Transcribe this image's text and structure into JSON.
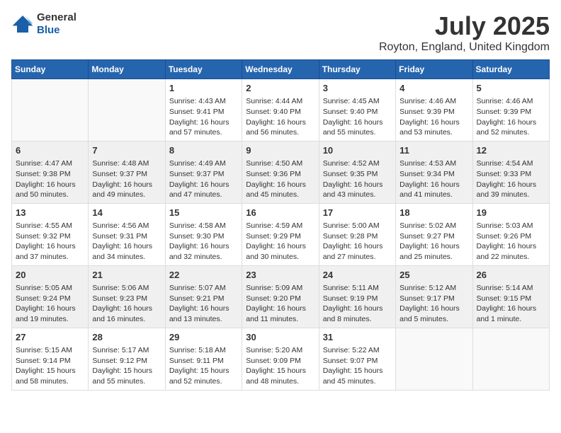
{
  "app": {
    "logo_line1": "General",
    "logo_line2": "Blue"
  },
  "title": "July 2025",
  "subtitle": "Royton, England, United Kingdom",
  "days_of_week": [
    "Sunday",
    "Monday",
    "Tuesday",
    "Wednesday",
    "Thursday",
    "Friday",
    "Saturday"
  ],
  "weeks": [
    [
      {
        "day": "",
        "info": ""
      },
      {
        "day": "",
        "info": ""
      },
      {
        "day": "1",
        "info": "Sunrise: 4:43 AM\nSunset: 9:41 PM\nDaylight: 16 hours and 57 minutes."
      },
      {
        "day": "2",
        "info": "Sunrise: 4:44 AM\nSunset: 9:40 PM\nDaylight: 16 hours and 56 minutes."
      },
      {
        "day": "3",
        "info": "Sunrise: 4:45 AM\nSunset: 9:40 PM\nDaylight: 16 hours and 55 minutes."
      },
      {
        "day": "4",
        "info": "Sunrise: 4:46 AM\nSunset: 9:39 PM\nDaylight: 16 hours and 53 minutes."
      },
      {
        "day": "5",
        "info": "Sunrise: 4:46 AM\nSunset: 9:39 PM\nDaylight: 16 hours and 52 minutes."
      }
    ],
    [
      {
        "day": "6",
        "info": "Sunrise: 4:47 AM\nSunset: 9:38 PM\nDaylight: 16 hours and 50 minutes."
      },
      {
        "day": "7",
        "info": "Sunrise: 4:48 AM\nSunset: 9:37 PM\nDaylight: 16 hours and 49 minutes."
      },
      {
        "day": "8",
        "info": "Sunrise: 4:49 AM\nSunset: 9:37 PM\nDaylight: 16 hours and 47 minutes."
      },
      {
        "day": "9",
        "info": "Sunrise: 4:50 AM\nSunset: 9:36 PM\nDaylight: 16 hours and 45 minutes."
      },
      {
        "day": "10",
        "info": "Sunrise: 4:52 AM\nSunset: 9:35 PM\nDaylight: 16 hours and 43 minutes."
      },
      {
        "day": "11",
        "info": "Sunrise: 4:53 AM\nSunset: 9:34 PM\nDaylight: 16 hours and 41 minutes."
      },
      {
        "day": "12",
        "info": "Sunrise: 4:54 AM\nSunset: 9:33 PM\nDaylight: 16 hours and 39 minutes."
      }
    ],
    [
      {
        "day": "13",
        "info": "Sunrise: 4:55 AM\nSunset: 9:32 PM\nDaylight: 16 hours and 37 minutes."
      },
      {
        "day": "14",
        "info": "Sunrise: 4:56 AM\nSunset: 9:31 PM\nDaylight: 16 hours and 34 minutes."
      },
      {
        "day": "15",
        "info": "Sunrise: 4:58 AM\nSunset: 9:30 PM\nDaylight: 16 hours and 32 minutes."
      },
      {
        "day": "16",
        "info": "Sunrise: 4:59 AM\nSunset: 9:29 PM\nDaylight: 16 hours and 30 minutes."
      },
      {
        "day": "17",
        "info": "Sunrise: 5:00 AM\nSunset: 9:28 PM\nDaylight: 16 hours and 27 minutes."
      },
      {
        "day": "18",
        "info": "Sunrise: 5:02 AM\nSunset: 9:27 PM\nDaylight: 16 hours and 25 minutes."
      },
      {
        "day": "19",
        "info": "Sunrise: 5:03 AM\nSunset: 9:26 PM\nDaylight: 16 hours and 22 minutes."
      }
    ],
    [
      {
        "day": "20",
        "info": "Sunrise: 5:05 AM\nSunset: 9:24 PM\nDaylight: 16 hours and 19 minutes."
      },
      {
        "day": "21",
        "info": "Sunrise: 5:06 AM\nSunset: 9:23 PM\nDaylight: 16 hours and 16 minutes."
      },
      {
        "day": "22",
        "info": "Sunrise: 5:07 AM\nSunset: 9:21 PM\nDaylight: 16 hours and 13 minutes."
      },
      {
        "day": "23",
        "info": "Sunrise: 5:09 AM\nSunset: 9:20 PM\nDaylight: 16 hours and 11 minutes."
      },
      {
        "day": "24",
        "info": "Sunrise: 5:11 AM\nSunset: 9:19 PM\nDaylight: 16 hours and 8 minutes."
      },
      {
        "day": "25",
        "info": "Sunrise: 5:12 AM\nSunset: 9:17 PM\nDaylight: 16 hours and 5 minutes."
      },
      {
        "day": "26",
        "info": "Sunrise: 5:14 AM\nSunset: 9:15 PM\nDaylight: 16 hours and 1 minute."
      }
    ],
    [
      {
        "day": "27",
        "info": "Sunrise: 5:15 AM\nSunset: 9:14 PM\nDaylight: 15 hours and 58 minutes."
      },
      {
        "day": "28",
        "info": "Sunrise: 5:17 AM\nSunset: 9:12 PM\nDaylight: 15 hours and 55 minutes."
      },
      {
        "day": "29",
        "info": "Sunrise: 5:18 AM\nSunset: 9:11 PM\nDaylight: 15 hours and 52 minutes."
      },
      {
        "day": "30",
        "info": "Sunrise: 5:20 AM\nSunset: 9:09 PM\nDaylight: 15 hours and 48 minutes."
      },
      {
        "day": "31",
        "info": "Sunrise: 5:22 AM\nSunset: 9:07 PM\nDaylight: 15 hours and 45 minutes."
      },
      {
        "day": "",
        "info": ""
      },
      {
        "day": "",
        "info": ""
      }
    ]
  ]
}
